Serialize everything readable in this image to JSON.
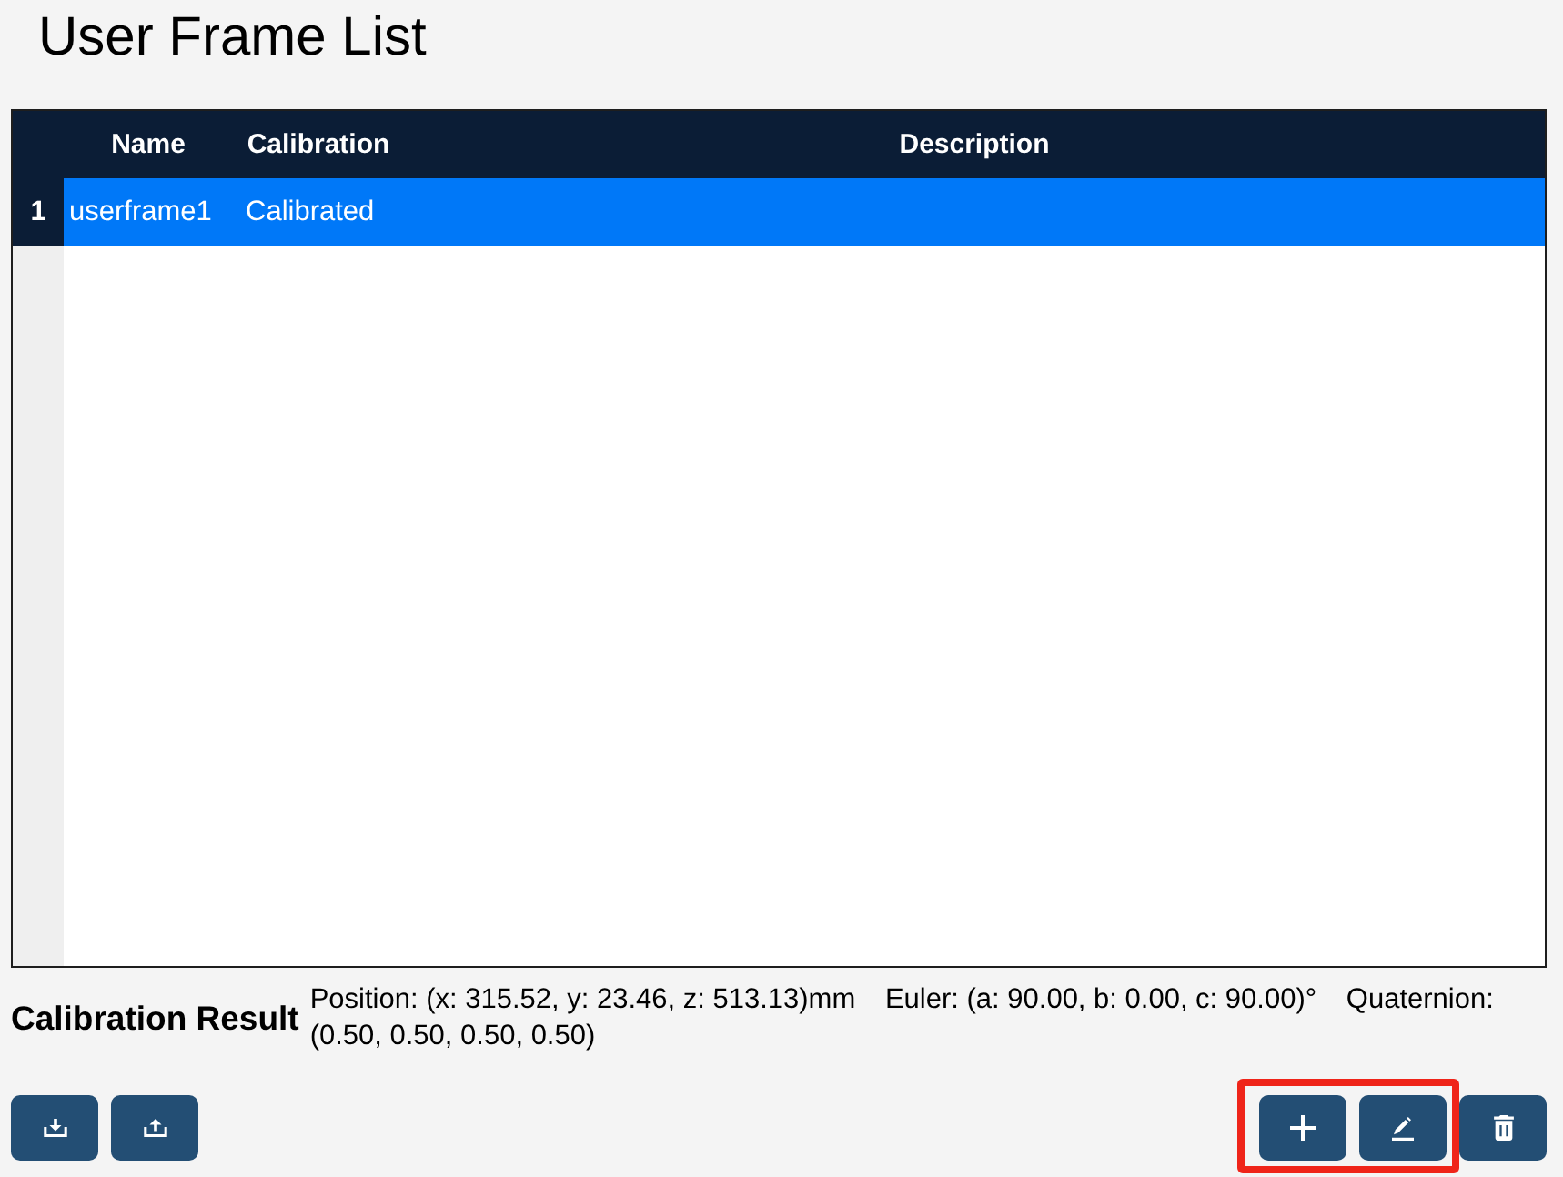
{
  "page": {
    "title": "User Frame List"
  },
  "table": {
    "columns": [
      "Name",
      "Calibration",
      "Description"
    ],
    "rows": [
      {
        "index": "1",
        "name": "userframe1",
        "calibration": "Calibrated",
        "selected": true
      }
    ]
  },
  "calibration_result": {
    "label": "Calibration Result",
    "position": "Position: (x: 315.52, y: 23.46, z: 513.13)mm",
    "euler": "Euler: (a: 90.00, b: 0.00, c: 90.00)°",
    "quaternion": "Quaternion: (0.50, 0.50, 0.50, 0.50)"
  },
  "toolbar": {
    "left": [
      {
        "kind": "import"
      },
      {
        "kind": "export"
      }
    ],
    "right": [
      {
        "kind": "add",
        "highlighted": true
      },
      {
        "kind": "edit",
        "highlighted": true
      },
      {
        "kind": "delete",
        "highlighted": false
      }
    ]
  }
}
